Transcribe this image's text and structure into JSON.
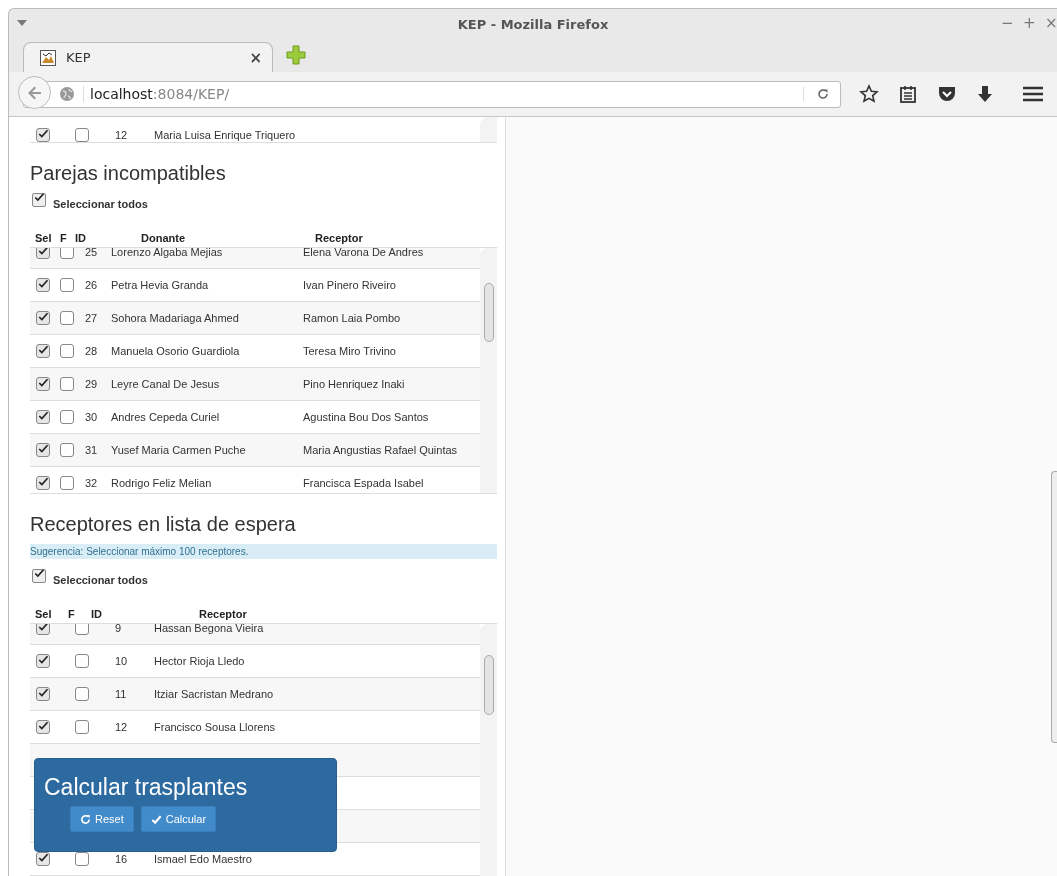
{
  "window": {
    "title": "KEP - Mozilla Firefox",
    "controls": [
      "−",
      "+",
      "×"
    ]
  },
  "tabs": [
    {
      "label": "KEP",
      "close": "×",
      "selected": true
    }
  ],
  "address_bar": {
    "host": "localhost",
    "path": ":8084/KEP/"
  },
  "previous_table": {
    "rows": [
      {
        "sel": true,
        "f": false,
        "id": "12",
        "name": "Maria Luisa Enrique Triquero"
      }
    ]
  },
  "pairs": {
    "title": "Parejas incompatibles",
    "select_all": {
      "label": "Seleccionar todos",
      "checked": true
    },
    "columns": [
      "Sel",
      "F",
      "ID",
      "Donante",
      "Receptor"
    ],
    "rows": [
      {
        "sel": true,
        "f": false,
        "id": "25",
        "donor": "Lorenzo Algaba Mejias",
        "recipient": "Elena Varona De Andres"
      },
      {
        "sel": true,
        "f": false,
        "id": "26",
        "donor": "Petra Hevia Granda",
        "recipient": "Ivan Pinero Riveiro"
      },
      {
        "sel": true,
        "f": false,
        "id": "27",
        "donor": "Sohora Madariaga Ahmed",
        "recipient": "Ramon Laia Pombo"
      },
      {
        "sel": true,
        "f": false,
        "id": "28",
        "donor": "Manuela Osorio Guardiola",
        "recipient": "Teresa Miro Trivino"
      },
      {
        "sel": true,
        "f": false,
        "id": "29",
        "donor": "Leyre Canal De Jesus",
        "recipient": "Pino Henriquez Inaki"
      },
      {
        "sel": true,
        "f": false,
        "id": "30",
        "donor": "Andres Cepeda Curiel",
        "recipient": "Agustina Bou Dos Santos"
      },
      {
        "sel": true,
        "f": false,
        "id": "31",
        "donor": "Yusef Maria Carmen Puche",
        "recipient": "Maria Angustias Rafael Quintas"
      },
      {
        "sel": true,
        "f": false,
        "id": "32",
        "donor": "Rodrigo Feliz Melian",
        "recipient": "Francisca Espada Isabel"
      }
    ]
  },
  "waiting": {
    "title": "Receptores en lista de espera",
    "hint": "Sugerencia: Seleccionar máximo 100 receptores.",
    "select_all": {
      "label": "Seleccionar todos",
      "checked": true
    },
    "columns": [
      "Sel",
      "F",
      "ID",
      "Receptor"
    ],
    "rows": [
      {
        "sel": true,
        "f": false,
        "id": "9",
        "recipient": "Hassan Begona Vieira"
      },
      {
        "sel": true,
        "f": false,
        "id": "10",
        "recipient": "Hector Rioja Lledo"
      },
      {
        "sel": true,
        "f": false,
        "id": "11",
        "recipient": "Itziar Sacristan Medrano"
      },
      {
        "sel": true,
        "f": false,
        "id": "12",
        "recipient": "Francisco Sousa Llorens"
      }
    ],
    "rows_below_panel": [
      {
        "sel": true,
        "f": false,
        "id": "16",
        "recipient": "Ismael Edo Maestro"
      }
    ]
  },
  "calc_panel": {
    "title": "Calcular trasplantes",
    "buttons": [
      {
        "kind": "reset",
        "label": "Reset"
      },
      {
        "kind": "calcular",
        "label": "Calcular"
      }
    ]
  }
}
